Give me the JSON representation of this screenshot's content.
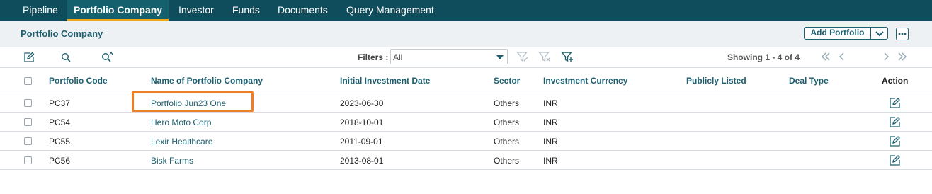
{
  "nav": {
    "tabs": [
      {
        "label": "Pipeline"
      },
      {
        "label": "Portfolio Company"
      },
      {
        "label": "Investor"
      },
      {
        "label": "Funds"
      },
      {
        "label": "Documents"
      },
      {
        "label": "Query Management"
      }
    ],
    "active_tab": "Portfolio Company"
  },
  "header": {
    "title": "Portfolio Company",
    "add_button_label": "Add Portfolio"
  },
  "toolbar": {
    "icons": [
      "edit-icon",
      "search-icon",
      "advanced-search-icon"
    ],
    "filters_label": "Filters :",
    "filter_value": "All",
    "filter_icons": [
      "filter-edit-icon",
      "filter-clear-icon",
      "filter-add-icon"
    ],
    "showing_text": "Showing 1 - 4 of 4"
  },
  "table": {
    "columns": [
      "Portfolio Code",
      "Name of Portfolio Company",
      "Initial Investment Date",
      "Sector",
      "Investment Currency",
      "Publicly Listed",
      "Deal Type",
      "Action"
    ],
    "rows": [
      {
        "code": "PC37",
        "name": "Portfolio Jun23 One",
        "date": "2023-06-30",
        "sector": "Others",
        "currency": "INR",
        "listed": "",
        "deal_type": ""
      },
      {
        "code": "PC54",
        "name": "Hero Moto Corp",
        "date": "2018-10-01",
        "sector": "Others",
        "currency": "INR",
        "listed": "",
        "deal_type": ""
      },
      {
        "code": "PC55",
        "name": "Lexir Healthcare",
        "date": "2011-09-01",
        "sector": "Others",
        "currency": "INR",
        "listed": "",
        "deal_type": ""
      },
      {
        "code": "PC56",
        "name": "Bisk Farms",
        "date": "2013-08-01",
        "sector": "Others",
        "currency": "INR",
        "listed": "",
        "deal_type": ""
      }
    ]
  },
  "colors": {
    "nav_bg": "#0f4c5c",
    "accent": "#1d5f6e",
    "active_underline": "#f2a516",
    "highlight_border": "#f07e26"
  }
}
